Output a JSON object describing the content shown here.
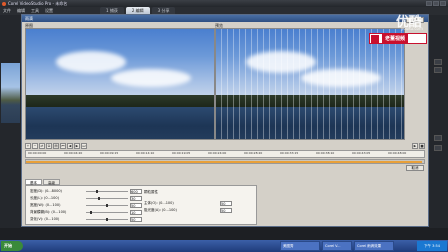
{
  "app": {
    "title": "Corel VideoStudio Pro - 未命名",
    "menu": [
      "文件",
      "编辑",
      "工具",
      "设置"
    ],
    "tabs": [
      {
        "label": "1 捕获",
        "active": false
      },
      {
        "label": "2 编辑",
        "active": true
      },
      {
        "label": "3 分享",
        "active": false
      }
    ]
  },
  "dialog": {
    "title": "雨滴",
    "original_label": "原图",
    "preview_label": "预览",
    "ok_label": "确定",
    "cancel_label": "取消",
    "badge_text": "老董视频"
  },
  "timeline": {
    "ticks": [
      "00:00:00:00",
      "00:00:04:20",
      "00:00:09:15",
      "00:00:14:10",
      "00:00:19:05",
      "00:00:24:00",
      "00:00:28:20",
      "00:00:33:15",
      "00:00:38:10",
      "00:00:43:05",
      "00:00:48:00"
    ]
  },
  "properties": {
    "tabs": [
      "基本",
      "高级"
    ],
    "rows": [
      {
        "label": "密度(D): (0...8000)",
        "value": "600",
        "level": 0.25
      },
      {
        "label": "长度(L): (0...100)",
        "value": "30",
        "level": 0.3
      },
      {
        "label": "宽度(W): (0...100)",
        "value": "50",
        "level": 0.5
      },
      {
        "label": "背景模糊(B): (0...100)",
        "value": "10",
        "level": 0.1
      },
      {
        "label": "变化(V): (0...100)",
        "value": "50",
        "level": 0.5
      }
    ],
    "group_label": "颗粒属性",
    "group_rows": [
      {
        "label": "主体(O): (0...100)",
        "value": "50"
      },
      {
        "label": "阻光度(A): (0...100)",
        "value": "50"
      }
    ]
  },
  "watermark": {
    "logo": "优酷",
    "sub": "youku.com"
  },
  "taskbar": {
    "start": "开始",
    "items": [
      "美图秀",
      "Corel V...",
      "Corel 雨滴效果"
    ],
    "clock": "下午 3:54"
  }
}
